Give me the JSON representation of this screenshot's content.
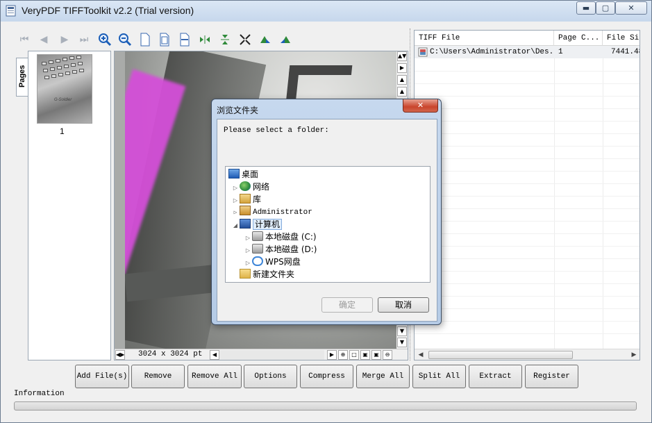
{
  "window": {
    "title": "VeryPDF TIFFToolkit v2.2 (Trial version)",
    "min_glyph": "▭",
    "max_glyph": "▢",
    "close_glyph": "✕"
  },
  "toolbar": {
    "icons": [
      "first-page-icon",
      "prev-page-icon",
      "next-page-icon",
      "last-page-icon",
      "zoom-in-icon",
      "zoom-out-icon",
      "page-icon",
      "fit-page-icon",
      "fit-width-icon",
      "flip-horizontal-icon",
      "flip-vertical-icon",
      "rotate-icon",
      "rotate-left-icon",
      "rotate-right-icon"
    ]
  },
  "pages_panel": {
    "tab_label": "Pages",
    "thumbnail_label": "1",
    "thumbnail_caption": "G-Soldier"
  },
  "viewer": {
    "dimensions": "3024 x 3024 pt"
  },
  "file_list": {
    "columns": [
      "TIFF File",
      "Page C...",
      "File Siz"
    ],
    "rows": [
      {
        "file": "C:\\Users\\Administrator\\Des...",
        "pages": "1",
        "size": "7441.48"
      }
    ]
  },
  "actions": {
    "buttons": [
      "Add File(s)",
      "Remove",
      "Remove All",
      "Options",
      "Compress",
      "Merge All",
      "Split All",
      "Extract",
      "Register"
    ]
  },
  "info": {
    "label": "Information"
  },
  "dialog": {
    "title": "浏览文件夹",
    "close_glyph": "✕",
    "message": "Please select a folder:",
    "tree": [
      {
        "label": "桌面",
        "icon": "desktop-icon"
      },
      {
        "label": "网络",
        "icon": "network-icon"
      },
      {
        "label": "库",
        "icon": "library-icon"
      },
      {
        "label": "Administrator",
        "icon": "user-folder-icon"
      },
      {
        "label": "计算机",
        "icon": "computer-icon"
      },
      {
        "label": "本地磁盘 (C:)",
        "icon": "local-disk-c-icon"
      },
      {
        "label": "本地磁盘 (D:)",
        "icon": "local-disk-d-icon"
      },
      {
        "label": "WPS网盘",
        "icon": "cloud-drive-icon"
      },
      {
        "label": "新建文件夹",
        "icon": "folder-icon"
      }
    ],
    "selected": "计算机",
    "ok_label": "确定",
    "cancel_label": "取消"
  }
}
